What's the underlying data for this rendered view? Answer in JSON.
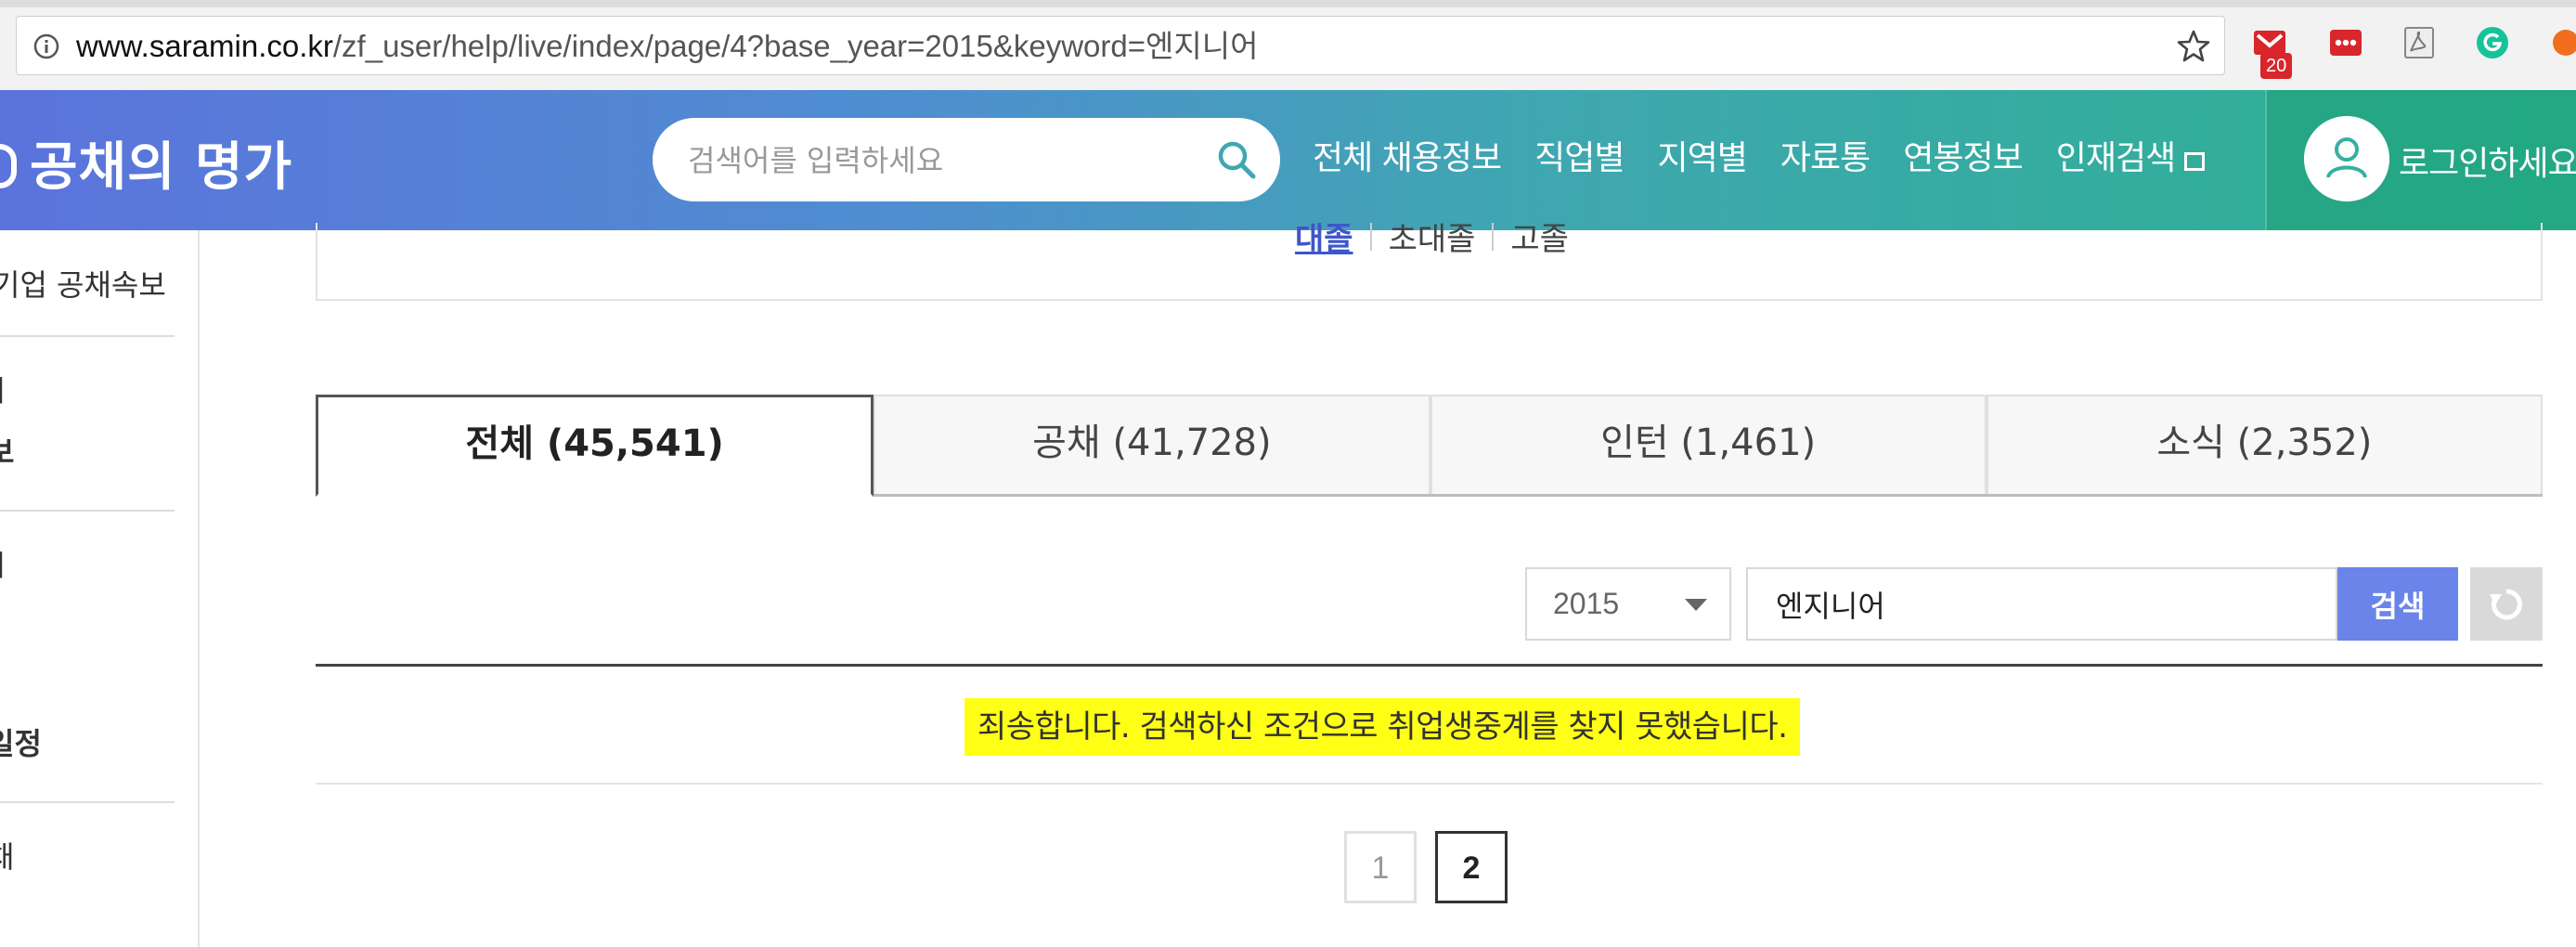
{
  "browser": {
    "url_host": "www.saramin.co.kr",
    "url_path": "/zf_user/help/live/index/page/4?base_year=2015&keyword=엔지니어",
    "gmail_badge": "20",
    "colors": {
      "gmail": "#d8262b",
      "grammarly": "#15c39a"
    }
  },
  "header": {
    "logo": "공채의 명가",
    "search_placeholder": "검색어를 입력하세요",
    "nav": [
      "전체 채용정보",
      "직업별",
      "지역별",
      "자료통",
      "연봉정보",
      "인재검색"
    ],
    "login": "로그인하세요"
  },
  "sidebar": {
    "items": [
      "기업 공채속보",
      "ㅣ",
      "보",
      "ㅣ",
      "일정",
      "채"
    ]
  },
  "grade_links": [
    "대졸",
    "초대졸",
    "고졸"
  ],
  "tabs": [
    {
      "label": "전체 (45,541)",
      "active": true
    },
    {
      "label": "공채 (41,728)",
      "active": false
    },
    {
      "label": "인턴 (1,461)",
      "active": false
    },
    {
      "label": "소식 (2,352)",
      "active": false
    }
  ],
  "filter": {
    "year": "2015",
    "keyword": "엔지니어",
    "search_button": "검색"
  },
  "result": {
    "empty_message": "죄송합니다. 검색하신 조건으로 취업생중계를 찾지 못했습니다."
  },
  "pagination": {
    "pages": [
      "1",
      "2"
    ],
    "current": "2"
  },
  "colors": {
    "header_gradient_start": "#5b73dc",
    "header_gradient_end": "#2bb190",
    "search_button": "#6b84ea",
    "highlight": "#ffff16"
  }
}
